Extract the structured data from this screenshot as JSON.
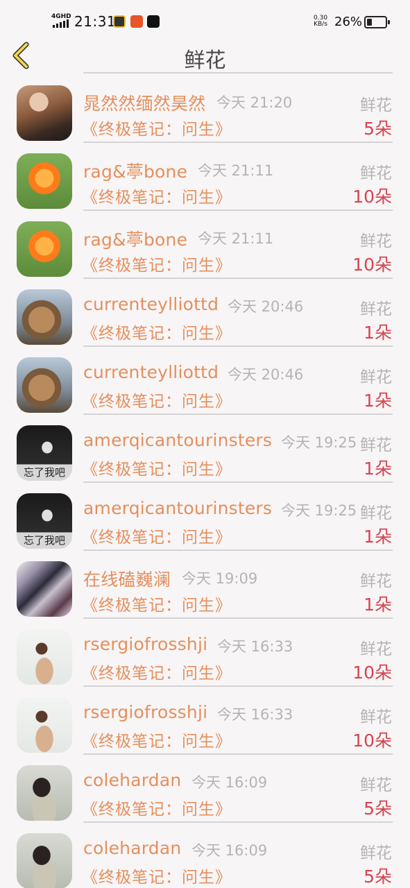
{
  "status_bar": {
    "network": "4GHD",
    "time": "21:31",
    "net_speed_value": "0.30",
    "net_speed_unit": "KB/s",
    "battery_percent": "26%",
    "battery_level": 0.26
  },
  "header": {
    "title": "鲜花",
    "back_icon": "chevron-left-icon"
  },
  "colors": {
    "username": "#e58f5c",
    "quantity": "#d9434e",
    "muted": "#b5b3b3",
    "back_icon": "#f2d64a"
  },
  "records": [
    {
      "user": "晁然然缅然昊然",
      "time": "今天 21:20",
      "gift": "鲜花",
      "book": "《终极笔记：问生》",
      "qty": "5朵"
    },
    {
      "user": "rag&葶bone",
      "time": "今天 21:11",
      "gift": "鲜花",
      "book": "《终极笔记：问生》",
      "qty": "10朵"
    },
    {
      "user": "rag&葶bone",
      "time": "今天 21:11",
      "gift": "鲜花",
      "book": "《终极笔记：问生》",
      "qty": "10朵"
    },
    {
      "user": "currenteylliottd",
      "time": "今天 20:46",
      "gift": "鲜花",
      "book": "《终极笔记：问生》",
      "qty": "1朵"
    },
    {
      "user": "currenteylliottd",
      "time": "今天 20:46",
      "gift": "鲜花",
      "book": "《终极笔记：问生》",
      "qty": "1朵"
    },
    {
      "user": "amerqicantourinsters",
      "time": "今天 19:25",
      "gift": "鲜花",
      "book": "《终极笔记：问生》",
      "qty": "1朵",
      "avatar_text": "忘了我吧"
    },
    {
      "user": "amerqicantourinsters",
      "time": "今天 19:25",
      "gift": "鲜花",
      "book": "《终极笔记：问生》",
      "qty": "1朵",
      "avatar_text": "忘了我吧"
    },
    {
      "user": "在线磕巍澜",
      "time": "今天 19:09",
      "gift": "鲜花",
      "book": "《终极笔记：问生》",
      "qty": "1朵"
    },
    {
      "user": "rsergiofrosshji",
      "time": "今天 16:33",
      "gift": "鲜花",
      "book": "《终极笔记：问生》",
      "qty": "10朵"
    },
    {
      "user": "rsergiofrosshji",
      "time": "今天 16:33",
      "gift": "鲜花",
      "book": "《终极笔记：问生》",
      "qty": "10朵"
    },
    {
      "user": "colehardan",
      "time": "今天 16:09",
      "gift": "鲜花",
      "book": "《终极笔记：问生》",
      "qty": "5朵"
    },
    {
      "user": "colehardan",
      "time": "今天 16:09",
      "gift": "鲜花",
      "book": "《终极笔记：问生》",
      "qty": "5朵"
    }
  ]
}
